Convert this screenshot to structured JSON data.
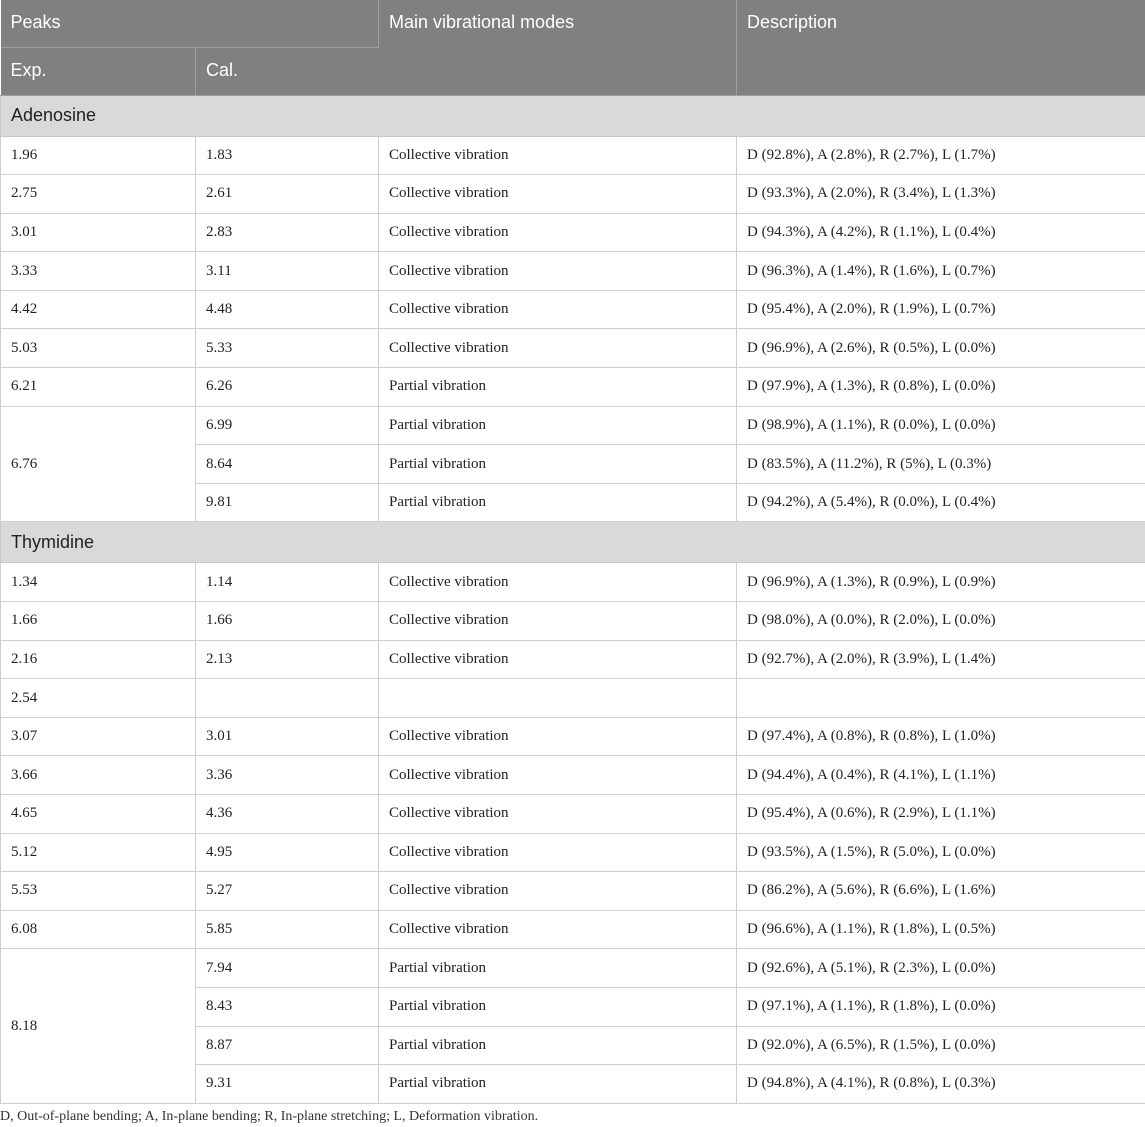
{
  "headers": {
    "peaks": "Peaks",
    "exp": "Exp.",
    "cal": "Cal.",
    "modes": "Main vibrational modes",
    "description": "Description"
  },
  "adenosine": {
    "label": "Adenosine",
    "rows": [
      {
        "exp": "1.96",
        "cal": "1.83",
        "mode": "Collective vibration",
        "desc": "D (92.8%), A (2.8%), R (2.7%), L (1.7%)"
      },
      {
        "exp": "2.75",
        "cal": "2.61",
        "mode": "Collective vibration",
        "desc": "D (93.3%), A (2.0%), R (3.4%), L (1.3%)"
      },
      {
        "exp": "3.01",
        "cal": "2.83",
        "mode": "Collective vibration",
        "desc": "D (94.3%), A (4.2%), R (1.1%), L (0.4%)"
      },
      {
        "exp": "3.33",
        "cal": "3.11",
        "mode": "Collective vibration",
        "desc": "D (96.3%), A (1.4%), R (1.6%), L (0.7%)"
      },
      {
        "exp": "4.42",
        "cal": "4.48",
        "mode": "Collective vibration",
        "desc": "D (95.4%), A (2.0%), R (1.9%), L (0.7%)"
      },
      {
        "exp": "5.03",
        "cal": "5.33",
        "mode": "Collective vibration",
        "desc": "D (96.9%), A (2.6%), R (0.5%), L (0.0%)"
      },
      {
        "exp": "6.21",
        "cal": "6.26",
        "mode": "Partial vibration",
        "desc": "D (97.9%), A (1.3%), R (0.8%), L (0.0%)"
      },
      {
        "exp": "6.76",
        "cal": "6.99",
        "mode": "Partial vibration",
        "desc": "D (98.9%), A (1.1%), R (0.0%), L (0.0%)"
      },
      {
        "cal": "8.64",
        "mode": "Partial vibration",
        "desc": "D (83.5%), A (11.2%), R (5%), L (0.3%)"
      },
      {
        "cal": "9.81",
        "mode": "Partial vibration",
        "desc": "D (94.2%), A (5.4%), R (0.0%), L (0.4%)"
      }
    ]
  },
  "thymidine": {
    "label": "Thymidine",
    "rows": [
      {
        "exp": "1.34",
        "cal": "1.14",
        "mode": "Collective vibration",
        "desc": "D (96.9%), A (1.3%), R (0.9%), L (0.9%)"
      },
      {
        "exp": "1.66",
        "cal": "1.66",
        "mode": "Collective vibration",
        "desc": "D (98.0%), A (0.0%), R (2.0%), L (0.0%)"
      },
      {
        "exp": "2.16",
        "cal": "2.13",
        "mode": "Collective vibration",
        "desc": "D (92.7%), A (2.0%), R (3.9%), L (1.4%)"
      },
      {
        "exp": "2.54",
        "cal": "",
        "mode": "",
        "desc": ""
      },
      {
        "exp": "3.07",
        "cal": "3.01",
        "mode": "Collective vibration",
        "desc": "D (97.4%), A (0.8%), R (0.8%), L (1.0%)"
      },
      {
        "exp": "3.66",
        "cal": "3.36",
        "mode": "Collective vibration",
        "desc": "D (94.4%), A (0.4%), R (4.1%), L (1.1%)"
      },
      {
        "exp": "4.65",
        "cal": "4.36",
        "mode": "Collective vibration",
        "desc": "D (95.4%), A (0.6%), R (2.9%), L (1.1%)"
      },
      {
        "exp": "5.12",
        "cal": "4.95",
        "mode": "Collective vibration",
        "desc": "D (93.5%), A (1.5%), R (5.0%), L (0.0%)"
      },
      {
        "exp": "5.53",
        "cal": "5.27",
        "mode": "Collective vibration",
        "desc": "D (86.2%), A (5.6%), R (6.6%), L (1.6%)"
      },
      {
        "exp": "6.08",
        "cal": "5.85",
        "mode": "Collective vibration",
        "desc": "D (96.6%), A (1.1%), R (1.8%), L (0.5%)"
      },
      {
        "exp": "8.18",
        "cal": "7.94",
        "mode": "Partial vibration",
        "desc": "D (92.6%), A (5.1%), R (2.3%), L (0.0%)"
      },
      {
        "cal": "8.43",
        "mode": "Partial vibration",
        "desc": "D (97.1%), A (1.1%), R (1.8%), L (0.0%)"
      },
      {
        "cal": "8.87",
        "mode": "Partial vibration",
        "desc": "D (92.0%), A (6.5%), R (1.5%), L (0.0%)"
      },
      {
        "cal": "9.31",
        "mode": "Partial vibration",
        "desc": "D (94.8%), A (4.1%), R (0.8%), L (0.3%)"
      }
    ]
  },
  "footnote": "D, Out-of-plane bending; A, In-plane bending; R, In-plane stretching; L, Deformation vibration."
}
